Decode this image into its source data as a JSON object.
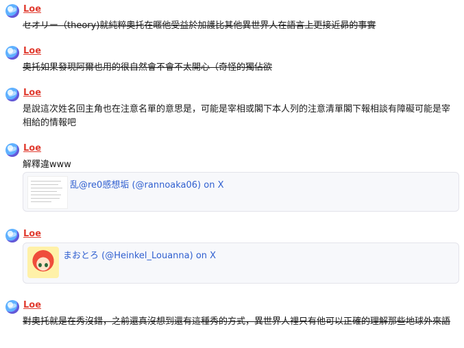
{
  "messages": [
    {
      "author": "Loe",
      "text": "セオリー（theory)就純粹奧托在暱他受益於加護比其他異世界人在語言上更接近昴的事實"
    },
    {
      "author": "Loe",
      "text": "奧托如果發現阿爾也用的很自然會不會不太開心（奇怪的獨佔欲"
    },
    {
      "author": "Loe",
      "text": "是說這次姓名回主角也在注意名單的意思是，可能是宰相或閣下本人列的注意清單閣下報相談有障礙可能是宰相給的情報吧"
    },
    {
      "author": "Loe",
      "text": "解釋違www",
      "embed_title": "乱@re0感想垢 (@rannoaka06) on X"
    },
    {
      "author": "Loe",
      "embed_title": "まおとろ (@Heinkel_Louanna) on X"
    },
    {
      "author": "Loe",
      "text": "對奧托就是在秀沒錯，之前還真沒想到還有這種秀的方式，異世界人裡只有他可以正確的理解那些地球外來語"
    }
  ]
}
